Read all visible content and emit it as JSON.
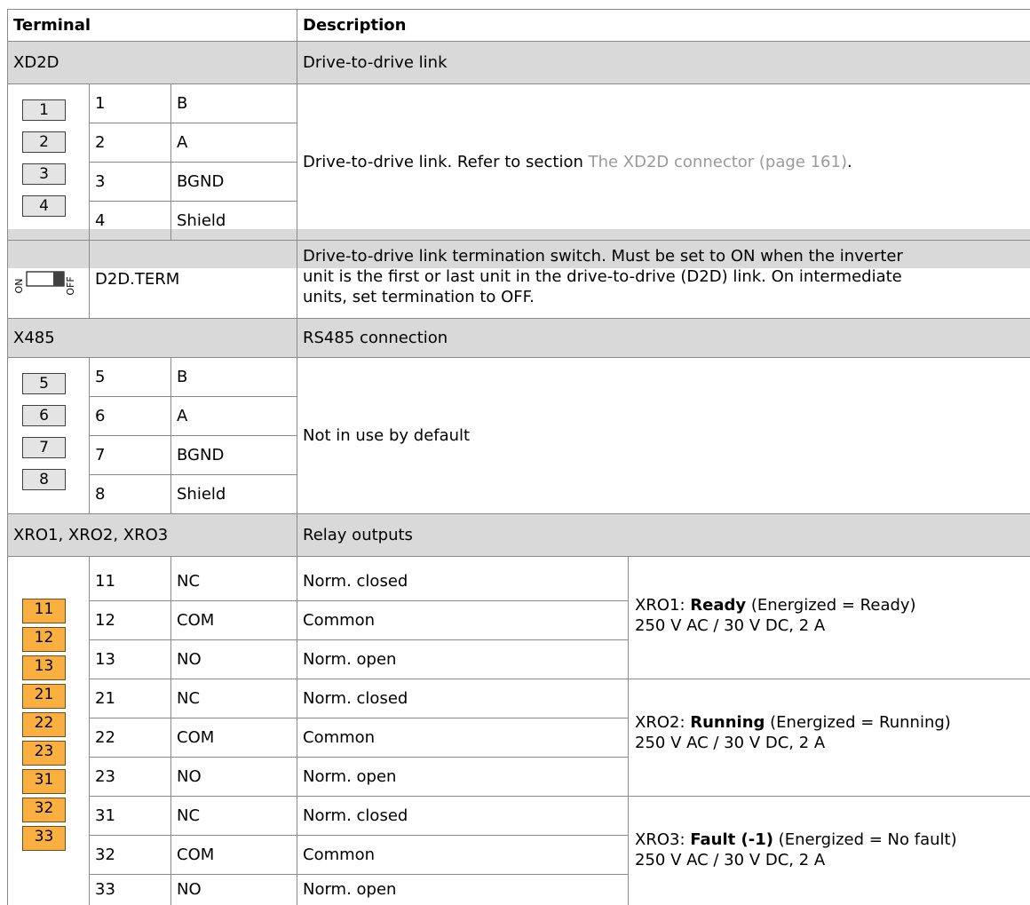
{
  "header": {
    "terminal": "Terminal",
    "description": "Description"
  },
  "xd2d": {
    "name": "XD2D",
    "title": "Drive-to-drive link",
    "pins": [
      {
        "num": "1",
        "label": "B"
      },
      {
        "num": "2",
        "label": "A"
      },
      {
        "num": "3",
        "label": "BGND"
      },
      {
        "num": "4",
        "label": "Shield"
      }
    ],
    "pin_icons": [
      "1",
      "2",
      "3",
      "4"
    ],
    "desc_prefix": "Drive-to-drive link. Refer to section ",
    "desc_link": "The XD2D connector (page 161)",
    "desc_suffix": "."
  },
  "d2d_term": {
    "switch_on": "ON",
    "switch_off": "OFF",
    "name": "D2D.TERM",
    "desc_lines": [
      "Drive-to-drive link termination switch. Must be set to ON when the inverter",
      "unit is the first or last unit in the drive-to-drive (D2D) link. On intermediate",
      "units, set termination to OFF."
    ]
  },
  "x485": {
    "name": "X485",
    "title": "RS485 connection",
    "pins": [
      {
        "num": "5",
        "label": "B"
      },
      {
        "num": "6",
        "label": "A"
      },
      {
        "num": "7",
        "label": "BGND"
      },
      {
        "num": "8",
        "label": "Shield"
      }
    ],
    "pin_icons": [
      "5",
      "6",
      "7",
      "8"
    ],
    "desc": "Not in use by default"
  },
  "relays": {
    "name": "XRO1, XRO2, XRO3",
    "title": "Relay outputs",
    "pin_icons": [
      "11",
      "12",
      "13",
      "21",
      "22",
      "23",
      "31",
      "32",
      "33"
    ],
    "rows": [
      {
        "num": "11",
        "code": "NC",
        "meaning": "Norm. closed"
      },
      {
        "num": "12",
        "code": "COM",
        "meaning": "Common"
      },
      {
        "num": "13",
        "code": "NO",
        "meaning": "Norm. open"
      },
      {
        "num": "21",
        "code": "NC",
        "meaning": "Norm. closed"
      },
      {
        "num": "22",
        "code": "COM",
        "meaning": "Common"
      },
      {
        "num": "23",
        "code": "NO",
        "meaning": "Norm. open"
      },
      {
        "num": "31",
        "code": "NC",
        "meaning": "Norm. closed"
      },
      {
        "num": "32",
        "code": "COM",
        "meaning": "Common"
      },
      {
        "num": "33",
        "code": "NO",
        "meaning": "Norm. open"
      }
    ],
    "groups": [
      {
        "prefix": "XRO1: ",
        "bold": "Ready",
        "suffix": " (Energized = Ready)",
        "rating": "250 V AC / 30 V DC, 2 A"
      },
      {
        "prefix": "XRO2: ",
        "bold": "Running",
        "suffix": " (Energized = Running)",
        "rating": "250 V AC / 30 V DC, 2 A"
      },
      {
        "prefix": "XRO3: ",
        "bold": "Fault (-1)",
        "suffix": " (Energized = No fault)",
        "rating": "250 V AC / 30 V DC, 2 A"
      }
    ]
  },
  "colors": {
    "header_gray": "#d9d9d9",
    "relay_orange": "#f9b040",
    "link_gray": "#9a9a9a"
  }
}
